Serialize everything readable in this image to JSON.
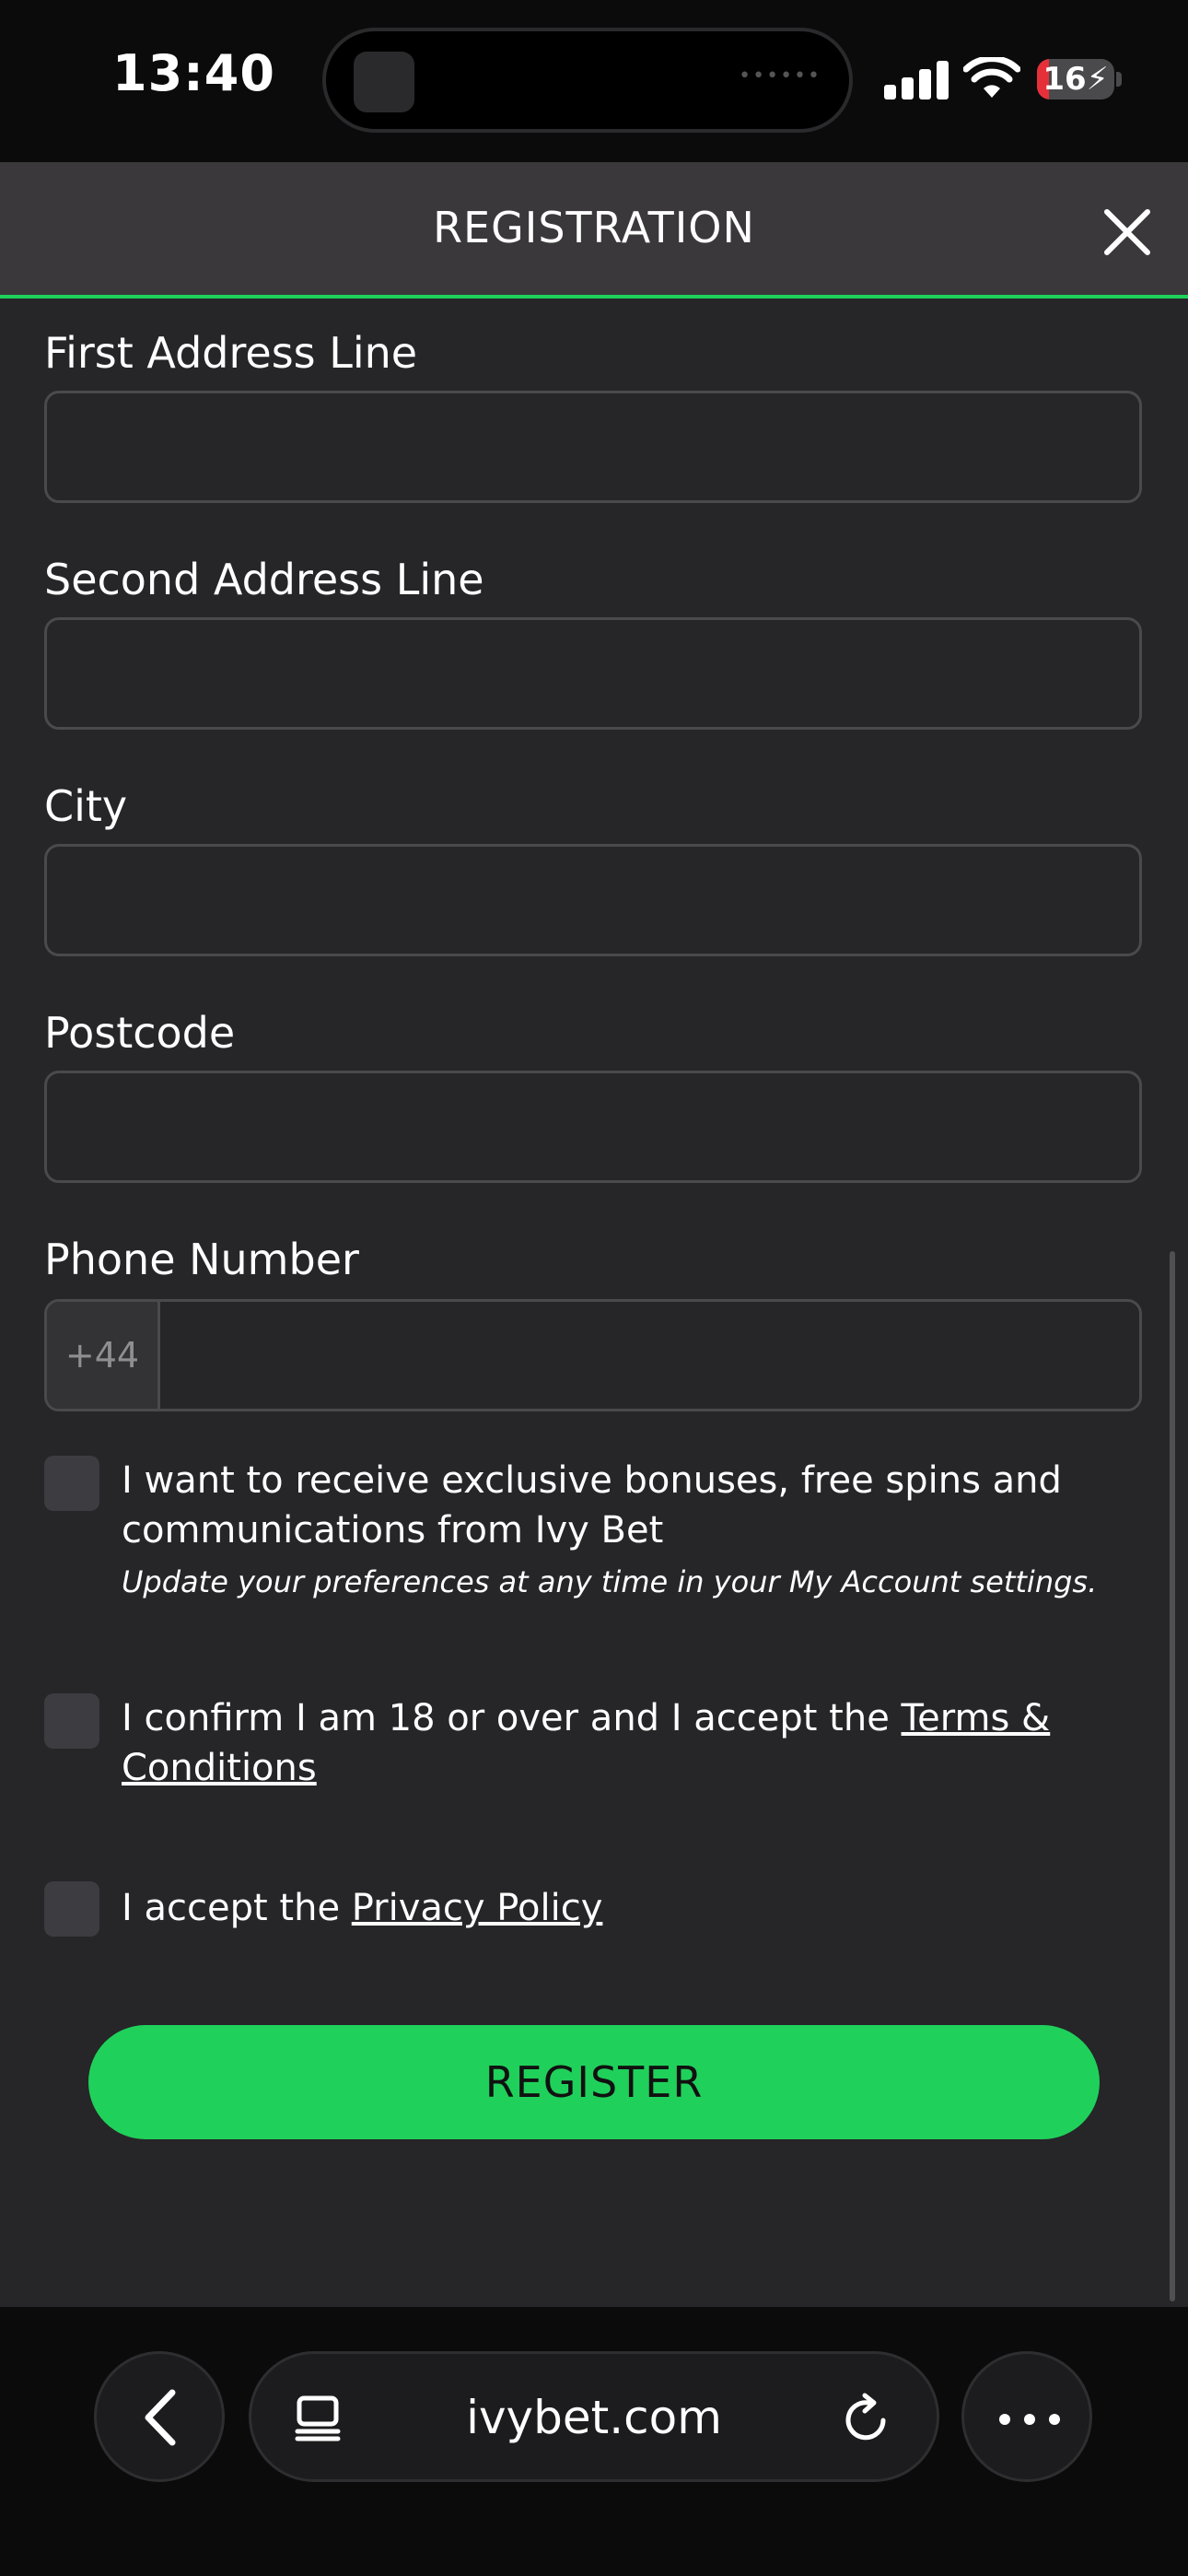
{
  "status_bar": {
    "time": "13:40",
    "battery_level": "16",
    "battery_fraction": 0.16
  },
  "header": {
    "title": "REGISTRATION"
  },
  "form": {
    "first_address_label": "First Address Line",
    "second_address_label": "Second Address Line",
    "city_label": "City",
    "postcode_label": "Postcode",
    "phone_label": "Phone Number",
    "phone_prefix": "+44",
    "marketing_text": "I want to receive exclusive bonuses, free spins and communications from Ivy Bet",
    "marketing_note": "Update your preferences at any time in your My Account settings.",
    "age_text_prefix": "I confirm I am 18 or over and I accept the ",
    "terms_link": "Terms & Conditions",
    "privacy_text_prefix": "I accept the ",
    "privacy_link": "Privacy Policy",
    "register_label": "REGISTER"
  },
  "browser": {
    "url": "ivybet.com"
  },
  "colors": {
    "accent": "#1fd15b",
    "background": "#262528",
    "header": "#3a383b",
    "battery_low": "#e5303a"
  },
  "icons": {
    "close": "close-icon",
    "back": "chevron-left-icon",
    "tabs": "tabs-icon",
    "reload": "reload-icon",
    "more": "more-dots-icon",
    "signal": "cellular-signal-icon",
    "wifi": "wifi-icon",
    "charging": "charging-bolt-icon"
  }
}
